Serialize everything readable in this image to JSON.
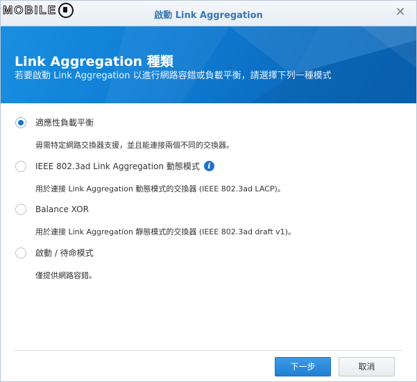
{
  "watermark": {
    "logo_text": "MOBILE"
  },
  "dialog": {
    "title": "啟動 Link Aggregation",
    "close_icon": "close-icon"
  },
  "banner": {
    "title": "Link Aggregation 種類",
    "subtitle": "若要啟動 Link Aggregation 以進行網路容錯或負載平衡，請選擇下列一種模式"
  },
  "options": [
    {
      "label": "適應性負載平衡",
      "description": "毋需特定網路交換器支援，並且能連接兩個不同的交換器。",
      "selected": true
    },
    {
      "label": "IEEE 802.3ad Link Aggregation 動態模式",
      "description": "用於連接 Link Aggregation 動態模式的交換器 (IEEE 802.3ad LACP)。",
      "selected": false,
      "info_icon": "info-icon"
    },
    {
      "label": "Balance XOR",
      "description": "用於連接 Link Aggregation 靜態模式的交換器 (IEEE 802.3ad draft v1)。",
      "selected": false
    },
    {
      "label": "啟動 / 待命模式",
      "description": "僅提供網路容錯。",
      "selected": false
    }
  ],
  "footer": {
    "next_label": "下一步",
    "cancel_label": "取消"
  },
  "colors": {
    "accent": "#1a73c9",
    "title_text": "#3677b7",
    "banner": "#0f7fd6"
  }
}
